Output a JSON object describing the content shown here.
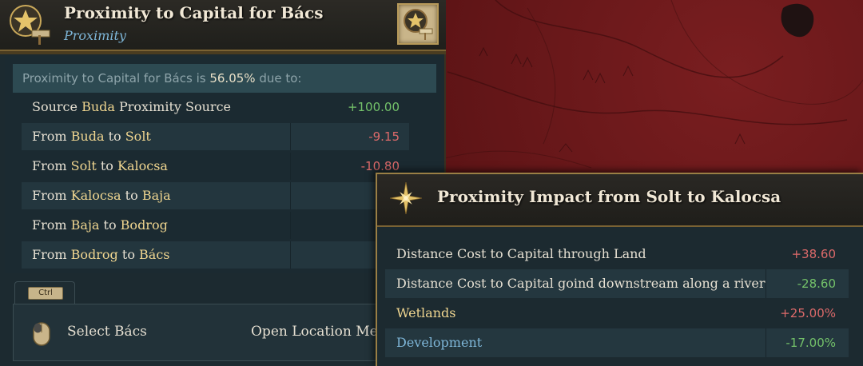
{
  "panel": {
    "title": "Proximity to Capital for Bács",
    "subtitle": "Proximity",
    "summary_prefix": "Proximity to Capital for Bács is ",
    "summary_value": "56.05%",
    "summary_suffix": " due to:",
    "rows": [
      {
        "pre": "Source ",
        "a": "Buda",
        "mid": " Proximity Source",
        "b": "",
        "value": "+100.00",
        "sign": "pos"
      },
      {
        "pre": "From ",
        "a": "Buda",
        "mid": " to ",
        "b": "Solt",
        "value": "-9.15",
        "sign": "neg"
      },
      {
        "pre": "From ",
        "a": "Solt",
        "mid": " to ",
        "b": "Kalocsa",
        "value": "-10.80",
        "sign": "neg"
      },
      {
        "pre": "From ",
        "a": "Kalocsa",
        "mid": " to ",
        "b": "Baja",
        "value": "",
        "sign": "neg"
      },
      {
        "pre": "From ",
        "a": "Baja",
        "mid": " to ",
        "b": "Bodrog",
        "value": "",
        "sign": "neg"
      },
      {
        "pre": "From ",
        "a": "Bodrog",
        "mid": " to ",
        "b": "Bács",
        "value": "",
        "sign": "neg"
      }
    ],
    "ctrl_key": "Ctrl",
    "action_left": "Select Bács",
    "action_right": "Open Location Menu"
  },
  "tooltip": {
    "title": "Proximity Impact from Solt to Kalocsa",
    "rows": [
      {
        "label": "Distance Cost to Capital through Land",
        "value": "+38.60",
        "sign": "neg",
        "style": "plain"
      },
      {
        "label": "Distance Cost to Capital goind downstream along a river",
        "value": "-28.60",
        "sign": "pos",
        "style": "plain"
      },
      {
        "label": "Wetlands",
        "value": "+25.00%",
        "sign": "neg",
        "style": "gold"
      },
      {
        "label": "Development",
        "value": "-17.00%",
        "sign": "pos",
        "style": "blue"
      }
    ]
  },
  "icons": {
    "panel_emblem": "star-signpost-icon",
    "pin_button": "star-signpost-icon",
    "tooltip_emblem": "compass-star-icon",
    "mouse": "mouse-icon"
  },
  "colors": {
    "positive": "#74c26a",
    "negative": "#dd6a6a",
    "highlight": "#f0d690",
    "accent_blue": "#7eb6d8",
    "map_red": "#6e1a1c"
  }
}
